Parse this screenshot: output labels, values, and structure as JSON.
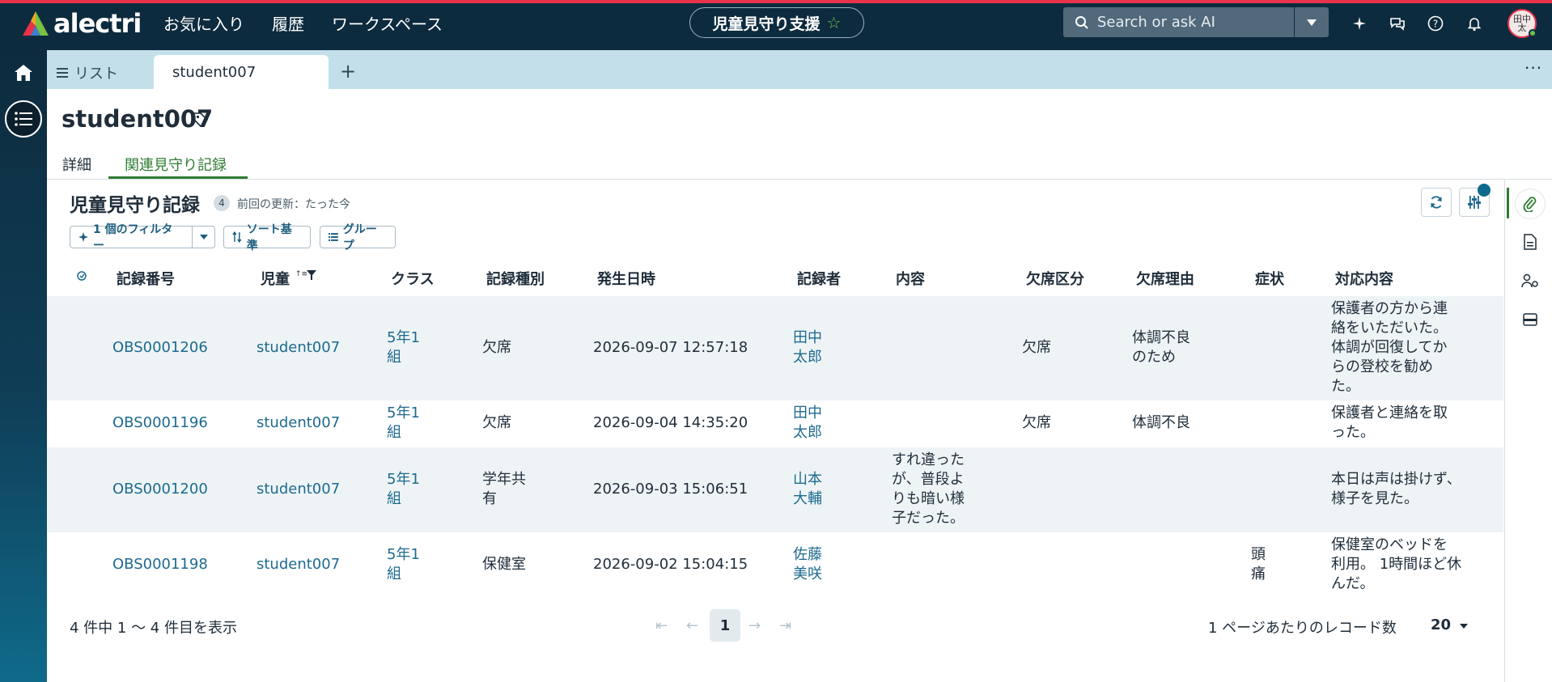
{
  "brand": {
    "name": "alectri"
  },
  "nav": [
    "お気に入り",
    "履歴",
    "ワークスペース"
  ],
  "app": {
    "name": "児童見守り支援"
  },
  "search": {
    "placeholder": "Search or ask AI"
  },
  "user": {
    "avatar_text": "田中\n太"
  },
  "tabs": {
    "list": "リスト",
    "active": "student007",
    "add": "+",
    "more": "···"
  },
  "record": {
    "title": "student007"
  },
  "subtabs": [
    "詳細",
    "関連見守り記録"
  ],
  "list": {
    "title": "児童見守り記録",
    "count": "4",
    "updated": "前回の更新：たった今",
    "filter_chip": "1 個のフィルター",
    "sort_chip": "ソート基準",
    "group_chip": "グループ"
  },
  "columns": [
    "記録番号",
    "児童",
    "クラス",
    "記録種別",
    "発生日時",
    "記録者",
    "内容",
    "欠席区分",
    "欠席理由",
    "症状",
    "対応内容"
  ],
  "rows": [
    {
      "id": "OBS0001206",
      "child": "student007",
      "class": "5年1\n組",
      "type": "欠席",
      "datetime": "2026-09-07 12:57:18",
      "recorder": "田中\n太郎",
      "content": "",
      "absence_type": "欠席",
      "absence_reason": "体調不良\nのため",
      "symptom": "",
      "response": "保護者の方から連\n絡をいただいた。\n体調が回復してか\nらの登校を勧め\nた。"
    },
    {
      "id": "OBS0001196",
      "child": "student007",
      "class": "5年1\n組",
      "type": "欠席",
      "datetime": "2026-09-04 14:35:20",
      "recorder": "田中\n太郎",
      "content": "",
      "absence_type": "欠席",
      "absence_reason": "体調不良",
      "symptom": "",
      "response": "保護者と連絡を取\nった。"
    },
    {
      "id": "OBS0001200",
      "child": "student007",
      "class": "5年1\n組",
      "type": "学年共\n有",
      "datetime": "2026-09-03 15:06:51",
      "recorder": "山本\n大輔",
      "content": "すれ違った\nが、普段よ\nりも暗い様\n子だった。",
      "absence_type": "",
      "absence_reason": "",
      "symptom": "",
      "response": "本日は声は掛けず、\n様子を見た。"
    },
    {
      "id": "OBS0001198",
      "child": "student007",
      "class": "5年1\n組",
      "type": "保健室",
      "datetime": "2026-09-02 15:04:15",
      "recorder": "佐藤\n美咲",
      "content": "",
      "absence_type": "",
      "absence_reason": "",
      "symptom": "頭\n痛",
      "response": "保健室のベッドを\n利用。 1時間ほど休\nんだ。"
    }
  ],
  "footer": {
    "summary": "4 件中 1 〜 4 件目を表示",
    "current_page": "1",
    "per_page_label": "1 ページあたりのレコード数",
    "per_page": "20"
  },
  "colors": {
    "header": "#0d2b3e",
    "accent": "#e8334a",
    "link": "#1d6a8f",
    "active_tab": "#2e7d32"
  }
}
